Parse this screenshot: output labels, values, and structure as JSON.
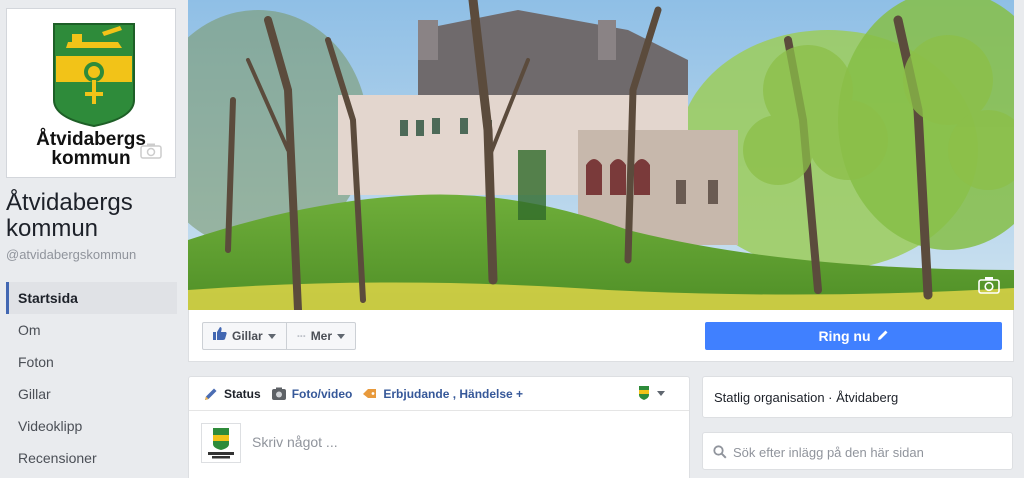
{
  "page": {
    "name": "Åtvidabergs kommun",
    "handle": "@atvidabergskommun",
    "logo_line1": "Åtvidabergs",
    "logo_line2": "kommun"
  },
  "nav": {
    "items": [
      {
        "label": "Startsida",
        "active": true
      },
      {
        "label": "Om"
      },
      {
        "label": "Foton"
      },
      {
        "label": "Gillar"
      },
      {
        "label": "Videoklipp"
      },
      {
        "label": "Recensioner"
      }
    ]
  },
  "actions": {
    "like_label": "Gillar",
    "more_label": "Mer",
    "call_label": "Ring nu"
  },
  "composer": {
    "status_label": "Status",
    "photo_label": "Foto/video",
    "offer_label": "Erbjudande , Händelse +",
    "placeholder": "Skriv något ..."
  },
  "sidebar": {
    "category": "Statlig organisation · Åtvidaberg",
    "search_placeholder": "Sök efter inlägg på den här sidan"
  },
  "colors": {
    "brand_blue": "#4267b2",
    "call_blue": "#4080ff",
    "shield_green": "#2e8b3a",
    "shield_yellow": "#f2c318"
  },
  "icons": {
    "like": "thumbs-up-icon",
    "camera": "camera-icon",
    "pencil": "pencil-icon",
    "search": "search-icon"
  }
}
